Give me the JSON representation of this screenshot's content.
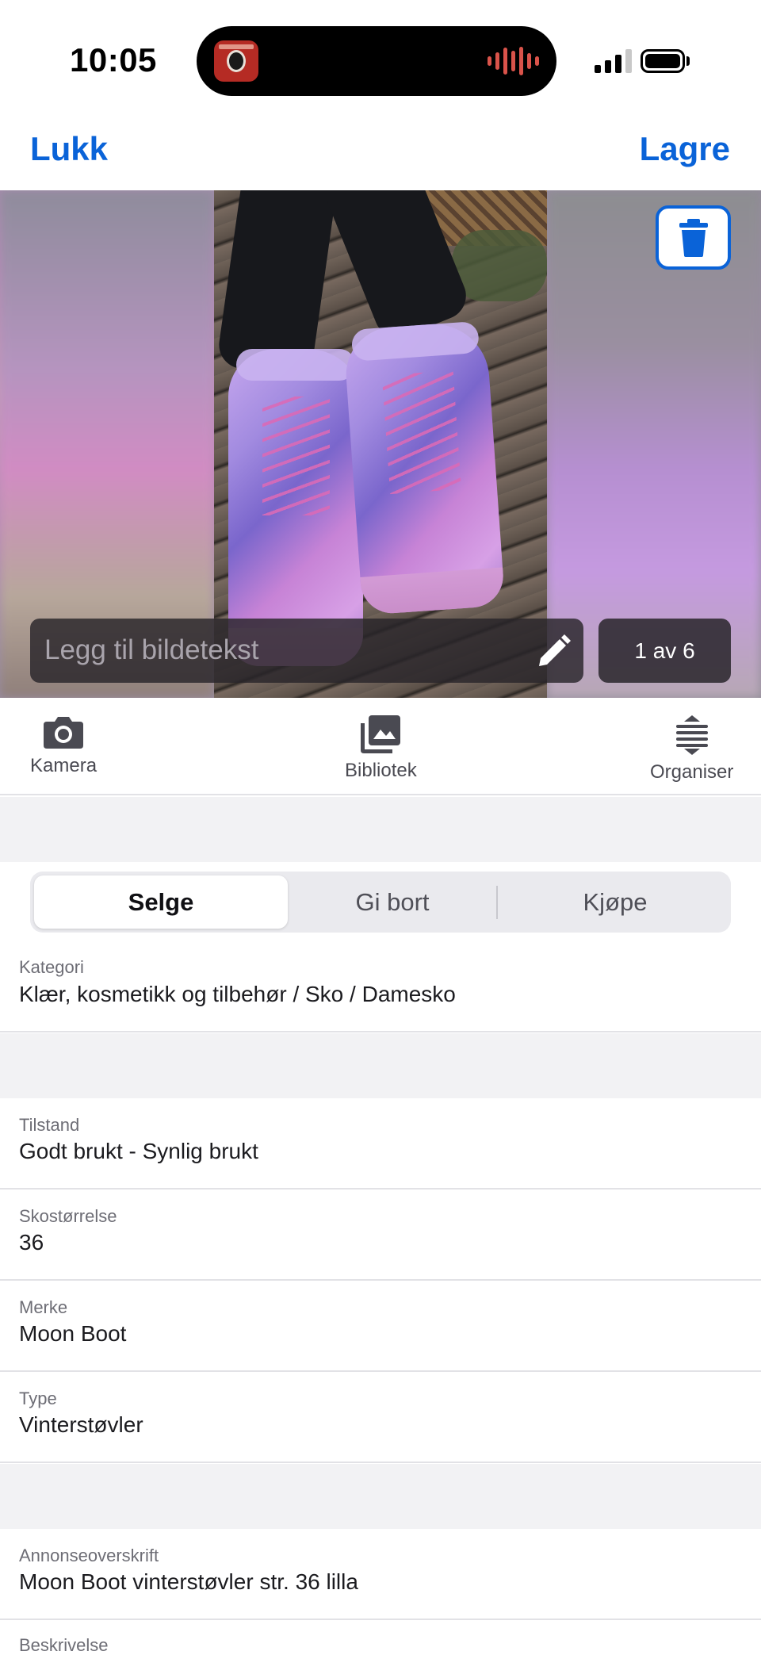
{
  "status_bar": {
    "time": "10:05",
    "now_playing_icon": "podcast-app-icon",
    "audio_icon": "waveform-icon",
    "signal_icon": "cellular-signal-icon",
    "battery_icon": "battery-icon"
  },
  "nav": {
    "close_label": "Lukk",
    "save_label": "Lagre"
  },
  "photo": {
    "delete_icon": "trash-icon",
    "caption_placeholder": "Legg til bildetekst",
    "edit_icon": "pencil-icon",
    "counter": "1 av 6"
  },
  "toolbar": {
    "camera_label": "Kamera",
    "library_label": "Bibliotek",
    "organize_label": "Organiser"
  },
  "segments": {
    "items": [
      "Selge",
      "Gi bort",
      "Kjøpe"
    ],
    "selected": "Selge"
  },
  "fields": {
    "category": {
      "label": "Kategori",
      "value": "Klær, kosmetikk og tilbehør / Sko / Damesko"
    },
    "condition": {
      "label": "Tilstand",
      "value": "Godt brukt - Synlig brukt"
    },
    "shoe_size": {
      "label": "Skostørrelse",
      "value": "36"
    },
    "brand": {
      "label": "Merke",
      "value": "Moon Boot"
    },
    "type": {
      "label": "Type",
      "value": "Vinterstøvler"
    },
    "headline": {
      "label": "Annonseoverskrift",
      "value": "Moon Boot vinterstøvler str. 36 lilla"
    },
    "description": {
      "label": "Beskrivelse"
    }
  },
  "colors": {
    "accent": "#0a63d8",
    "segment_bg": "#eaeaee",
    "band_bg": "#f2f2f4"
  }
}
